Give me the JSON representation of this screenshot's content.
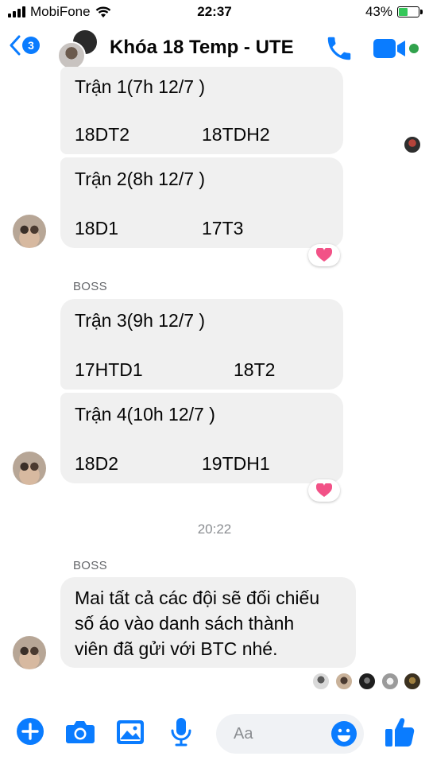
{
  "status_bar": {
    "carrier": "MobiFone",
    "time": "22:37",
    "battery": "43%",
    "battery_level": 0.43
  },
  "header": {
    "back_count": "3",
    "title": "Khóa 18 Temp - UTE"
  },
  "messages": [
    {
      "lines": [
        "Trận 1(7h 12/7 )",
        "18DT2",
        "18TDH2"
      ]
    },
    {
      "lines": [
        "Trận 2(8h 12/7 )",
        "18D1",
        "17T3"
      ]
    },
    {
      "sender": "BOSS",
      "lines": [
        "Trận 3(9h 12/7 )",
        "17HTD1",
        "18T2"
      ]
    },
    {
      "lines": [
        "Trận 4(10h 12/7 )",
        "18D2",
        "19TDH1"
      ]
    },
    {
      "sender": "BOSS",
      "lines": [
        "Mai tất cả các đội sẽ đối chiếu",
        "số áo vào danh sách thành",
        "viên đã gửi với BTC nhé."
      ]
    }
  ],
  "timestamp": "20:22",
  "reactions": [
    "heart-emoji",
    "heart-emoji"
  ],
  "composer": {
    "placeholder": "Aa"
  },
  "colors": {
    "accent": "#0a7cff",
    "bubble": "#f0f0f0",
    "online": "#31a24c",
    "heart": "#f25287"
  }
}
